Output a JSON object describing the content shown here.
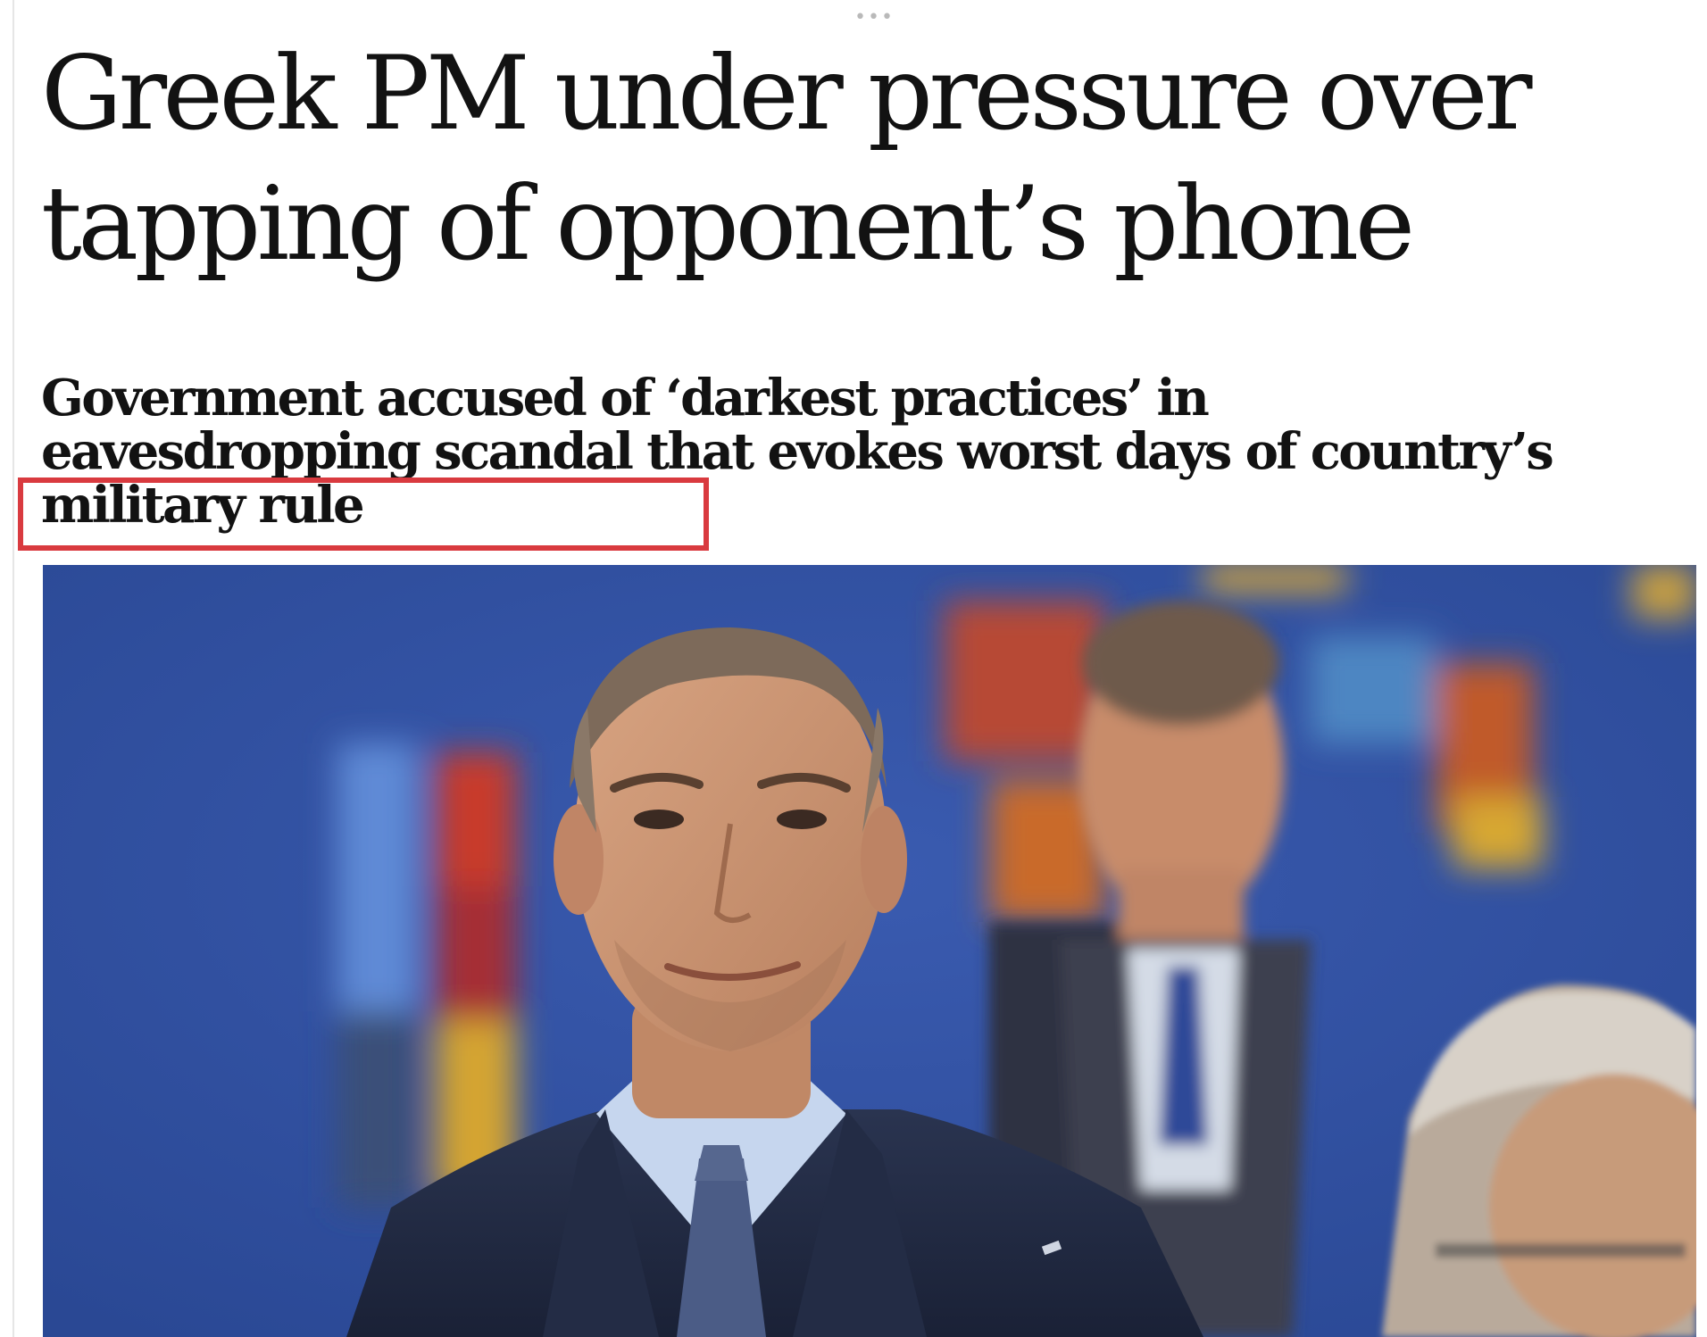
{
  "overflow_indicator": "•••",
  "article": {
    "headline": "Greek PM under pressure over tapping of opponent’s phone",
    "standfirst": "Government accused of ‘darkest practices’ in eavesdropping scandal that evokes worst days of country’s military rule",
    "highlighted_phrase": "country’s military rule"
  },
  "colors": {
    "headline_text": "#121212",
    "highlight_border": "#d93a3f",
    "photo_background": "#2f4fa0"
  }
}
